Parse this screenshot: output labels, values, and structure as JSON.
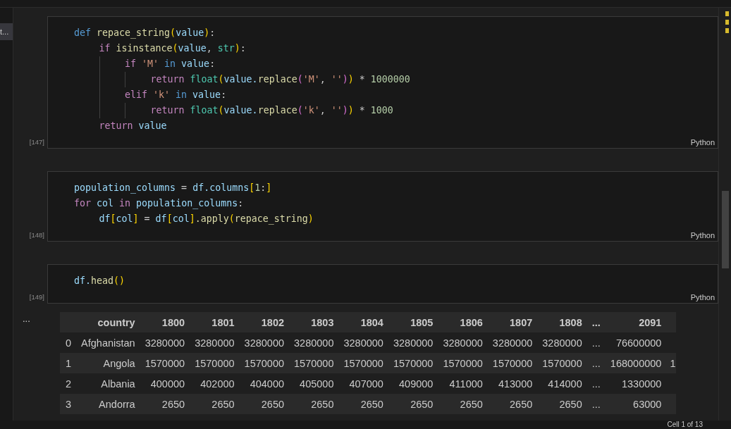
{
  "sidebar": {
    "items": [
      {
        "label": "t...",
        "selected": true
      }
    ]
  },
  "cells": [
    {
      "number": "[147]",
      "language": "Python",
      "lines": [
        {
          "tokens": [
            {
              "t": "def ",
              "kind": "decl"
            },
            {
              "t": "repace_string",
              "kind": "func"
            },
            {
              "t": "(",
              "kind": "bracket"
            },
            {
              "t": "value",
              "kind": "var"
            },
            {
              "t": ")",
              "kind": "bracket"
            },
            {
              "t": ":",
              "kind": "plain"
            }
          ],
          "children": [
            {
              "tokens": [
                {
                  "t": "if ",
                  "kind": "ctrl"
                },
                {
                  "t": "isinstance",
                  "kind": "func"
                },
                {
                  "t": "(",
                  "kind": "bracket"
                },
                {
                  "t": "value",
                  "kind": "var"
                },
                {
                  "t": ", ",
                  "kind": "plain"
                },
                {
                  "t": "str",
                  "kind": "type"
                },
                {
                  "t": ")",
                  "kind": "bracket"
                },
                {
                  "t": ":",
                  "kind": "plain"
                }
              ],
              "children": [
                {
                  "tokens": [
                    {
                      "t": "if ",
                      "kind": "ctrl"
                    },
                    {
                      "t": "'M' ",
                      "kind": "str"
                    },
                    {
                      "t": "in ",
                      "kind": "decl"
                    },
                    {
                      "t": "value",
                      "kind": "var"
                    },
                    {
                      "t": ":",
                      "kind": "plain"
                    }
                  ],
                  "children": [
                    {
                      "tokens": [
                        {
                          "t": "return ",
                          "kind": "ctrl"
                        },
                        {
                          "t": "float",
                          "kind": "type"
                        },
                        {
                          "t": "(",
                          "kind": "bracket"
                        },
                        {
                          "t": "value.",
                          "kind": "var"
                        },
                        {
                          "t": "replace",
                          "kind": "func"
                        },
                        {
                          "t": "(",
                          "kind": "bracket2"
                        },
                        {
                          "t": "'M'",
                          "kind": "str"
                        },
                        {
                          "t": ", ",
                          "kind": "plain"
                        },
                        {
                          "t": "''",
                          "kind": "str"
                        },
                        {
                          "t": ")",
                          "kind": "bracket2"
                        },
                        {
                          "t": ")",
                          "kind": "bracket"
                        },
                        {
                          "t": " * ",
                          "kind": "plain"
                        },
                        {
                          "t": "1000000",
                          "kind": "num"
                        }
                      ]
                    }
                  ]
                },
                {
                  "tokens": [
                    {
                      "t": "elif ",
                      "kind": "ctrl"
                    },
                    {
                      "t": "'k' ",
                      "kind": "str"
                    },
                    {
                      "t": "in ",
                      "kind": "decl"
                    },
                    {
                      "t": "value",
                      "kind": "var"
                    },
                    {
                      "t": ":",
                      "kind": "plain"
                    }
                  ],
                  "children": [
                    {
                      "tokens": [
                        {
                          "t": "return ",
                          "kind": "ctrl"
                        },
                        {
                          "t": "float",
                          "kind": "type"
                        },
                        {
                          "t": "(",
                          "kind": "bracket"
                        },
                        {
                          "t": "value.",
                          "kind": "var"
                        },
                        {
                          "t": "replace",
                          "kind": "func"
                        },
                        {
                          "t": "(",
                          "kind": "bracket2"
                        },
                        {
                          "t": "'k'",
                          "kind": "str"
                        },
                        {
                          "t": ", ",
                          "kind": "plain"
                        },
                        {
                          "t": "''",
                          "kind": "str"
                        },
                        {
                          "t": ")",
                          "kind": "bracket2"
                        },
                        {
                          "t": ")",
                          "kind": "bracket"
                        },
                        {
                          "t": " * ",
                          "kind": "plain"
                        },
                        {
                          "t": "1000",
                          "kind": "num"
                        }
                      ]
                    }
                  ]
                }
              ]
            },
            {
              "tokens": [
                {
                  "t": "return ",
                  "kind": "ctrl"
                },
                {
                  "t": "value",
                  "kind": "var"
                }
              ]
            }
          ]
        }
      ]
    },
    {
      "number": "[148]",
      "language": "Python",
      "lines": [
        {
          "tokens": [
            {
              "t": "population_columns",
              "kind": "var"
            },
            {
              "t": " = ",
              "kind": "plain"
            },
            {
              "t": "df.columns",
              "kind": "var"
            },
            {
              "t": "[",
              "kind": "bracket"
            },
            {
              "t": "1",
              "kind": "num"
            },
            {
              "t": ":",
              "kind": "plain"
            },
            {
              "t": "]",
              "kind": "bracket"
            }
          ]
        },
        {
          "tokens": [
            {
              "t": "for ",
              "kind": "ctrl"
            },
            {
              "t": "col ",
              "kind": "var"
            },
            {
              "t": "in ",
              "kind": "ctrl"
            },
            {
              "t": "population_columns",
              "kind": "var"
            },
            {
              "t": ":",
              "kind": "plain"
            }
          ],
          "children": [
            {
              "tokens": [
                {
                  "t": "df",
                  "kind": "var"
                },
                {
                  "t": "[",
                  "kind": "bracket"
                },
                {
                  "t": "col",
                  "kind": "var"
                },
                {
                  "t": "]",
                  "kind": "bracket"
                },
                {
                  "t": " = ",
                  "kind": "plain"
                },
                {
                  "t": "df",
                  "kind": "var"
                },
                {
                  "t": "[",
                  "kind": "bracket"
                },
                {
                  "t": "col",
                  "kind": "var"
                },
                {
                  "t": "]",
                  "kind": "bracket"
                },
                {
                  "t": ".apply",
                  "kind": "func"
                },
                {
                  "t": "(",
                  "kind": "bracket"
                },
                {
                  "t": "repace_string",
                  "kind": "func"
                },
                {
                  "t": ")",
                  "kind": "bracket"
                }
              ]
            }
          ]
        }
      ]
    },
    {
      "number": "[149]",
      "language": "Python",
      "lines": [
        {
          "tokens": [
            {
              "t": "df.",
              "kind": "var"
            },
            {
              "t": "head",
              "kind": "func"
            },
            {
              "t": "()",
              "kind": "bracket"
            }
          ]
        }
      ]
    }
  ],
  "output": {
    "menu": "...",
    "table": {
      "columns": [
        "",
        "country",
        "1800",
        "1801",
        "1802",
        "1803",
        "1804",
        "1805",
        "1806",
        "1807",
        "1808",
        "...",
        "2091"
      ],
      "rows": [
        {
          "cells": [
            "0",
            "Afghanistan",
            "3280000",
            "3280000",
            "3280000",
            "3280000",
            "3280000",
            "3280000",
            "3280000",
            "3280000",
            "3280000",
            "...",
            "76600000"
          ]
        },
        {
          "cells": [
            "1",
            "Angola",
            "1570000",
            "1570000",
            "1570000",
            "1570000",
            "1570000",
            "1570000",
            "1570000",
            "1570000",
            "1570000",
            "...",
            "168000000"
          ],
          "overflow": "1"
        },
        {
          "cells": [
            "2",
            "Albania",
            "400000",
            "402000",
            "404000",
            "405000",
            "407000",
            "409000",
            "411000",
            "413000",
            "414000",
            "...",
            "1330000"
          ]
        },
        {
          "cells": [
            "3",
            "Andorra",
            "2650",
            "2650",
            "2650",
            "2650",
            "2650",
            "2650",
            "2650",
            "2650",
            "2650",
            "...",
            "63000"
          ]
        }
      ]
    }
  },
  "status_bar": {
    "text": "Cell 1 of 13"
  }
}
